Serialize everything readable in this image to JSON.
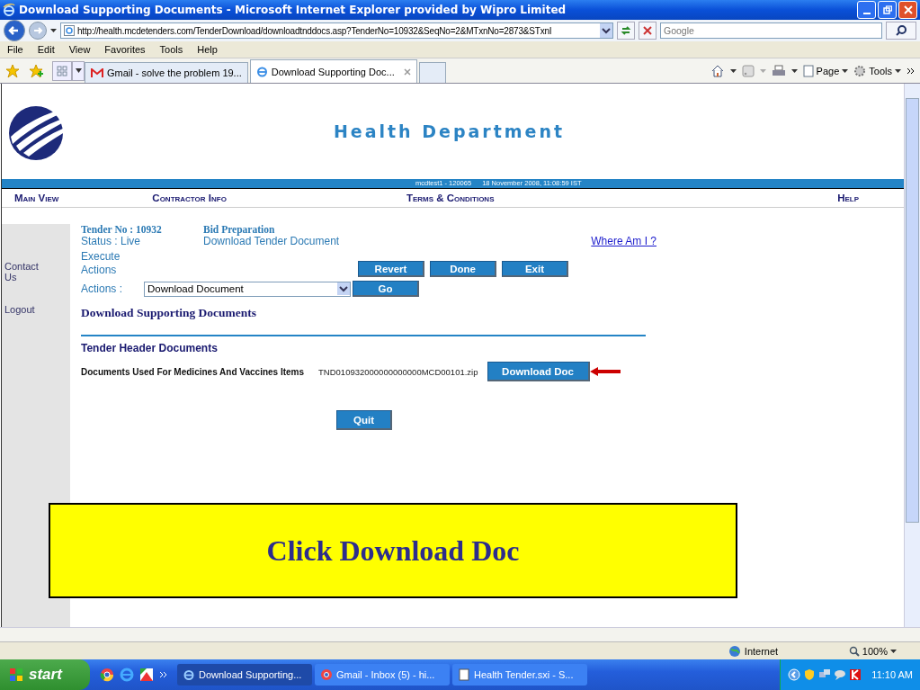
{
  "window": {
    "title": "Download Supporting Documents - Microsoft Internet Explorer provided by Wipro Limited"
  },
  "address": "http://health.mcdetenders.com/TenderDownload/downloadtnddocs.asp?TenderNo=10932&SeqNo=2&MTxnNo=2873&STxnI",
  "search": {
    "placeholder": "Google"
  },
  "menu": [
    "File",
    "Edit",
    "View",
    "Favorites",
    "Tools",
    "Help"
  ],
  "tabs": [
    {
      "label": "Gmail - solve the problem 19...",
      "kind": "gmail",
      "selected": false
    },
    {
      "label": "Download Supporting Doc...",
      "kind": "ie",
      "selected": true
    }
  ],
  "command_bar": [
    "Page",
    "Tools"
  ],
  "page": {
    "title": "Health Department",
    "session": "mcdtest1 - 120065",
    "datetime": "18 November 2008,  11:08:59  IST",
    "nav": [
      "Main View",
      "Contractor Info",
      "Terms & Conditions",
      "Help"
    ],
    "sidebar": [
      "Contact Us",
      "Logout"
    ],
    "tender_no": "Tender No : 10932",
    "status": "Status : Live",
    "bid_label": "Bid Preparation",
    "stage": "Download Tender Document",
    "where_link": "Where Am I ?",
    "execute_label": "Execute Actions",
    "buttons": [
      "Revert",
      "Done",
      "Exit"
    ],
    "actions_label": "Actions :",
    "actions_value": "Download Document",
    "go": "Go",
    "section_title": "Download Supporting Documents",
    "subsection": "Tender Header Documents",
    "document": {
      "name": "Documents Used For Medicines And Vaccines Items",
      "file": "TND010932000000000000MCD00101.zip",
      "button": "Download Doc"
    },
    "quit": "Quit"
  },
  "callout": "Click Download Doc",
  "status_bar": {
    "zone": "Internet",
    "zoom": "100%"
  },
  "taskbar": {
    "start": "start",
    "tasks": [
      {
        "label": "Download Supporting...",
        "kind": "ie",
        "selected": true
      },
      {
        "label": "Gmail - Inbox (5) - hi...",
        "kind": "chrome",
        "selected": false
      },
      {
        "label": "Health Tender.sxi - S...",
        "kind": "doc",
        "selected": false
      }
    ],
    "clock": "11:10 AM"
  }
}
